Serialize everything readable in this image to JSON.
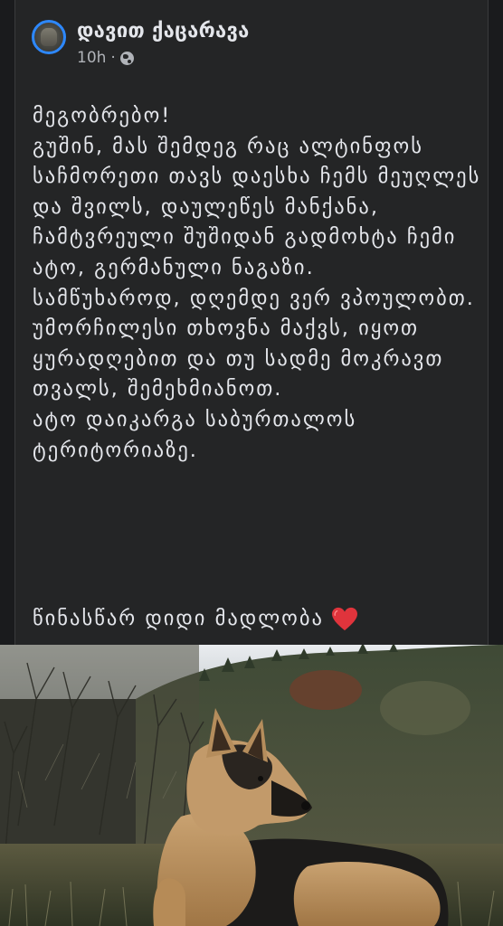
{
  "post": {
    "author": "დავით ქაცარავა",
    "time": "10h",
    "separator": "·",
    "privacy_icon": "globe-icon",
    "avatar": "avatar",
    "body": "მეგობრებო!\nგუშინ, მას შემდეგ რაც ალტინფოს საჩმორეთი თავს დაესხა ჩემს მეუღლეს და შვილს, დაულეწეს მანქანა, ჩამტვრეული შუშიდან გადმოხტა ჩემი ატო, გერმანული ნაგაზი.\nსამწუხაროდ, დღემდე ვერ ვპოულობთ.\nუმორჩილესი თხოვნა მაქვს, იყოთ ყურადღებით და თუ სადმე მოკრავთ თვალს, შემეხმიანოთ.\nატო დაიკარგა საბურთალოს ტერიტორიაზე.",
    "thanks": "წინასწარ დიდი მადლობა",
    "thanks_icon": "heart-icon",
    "photo": "photo of a german shepherd dog lying on grass"
  },
  "colors": {
    "card_bg": "#242526",
    "page_bg": "#1a1b1d",
    "text": "#e4e6eb",
    "secondary_text": "#b0b3b8",
    "avatar_ring": "#2d88ff",
    "heart": "#e0343c"
  }
}
